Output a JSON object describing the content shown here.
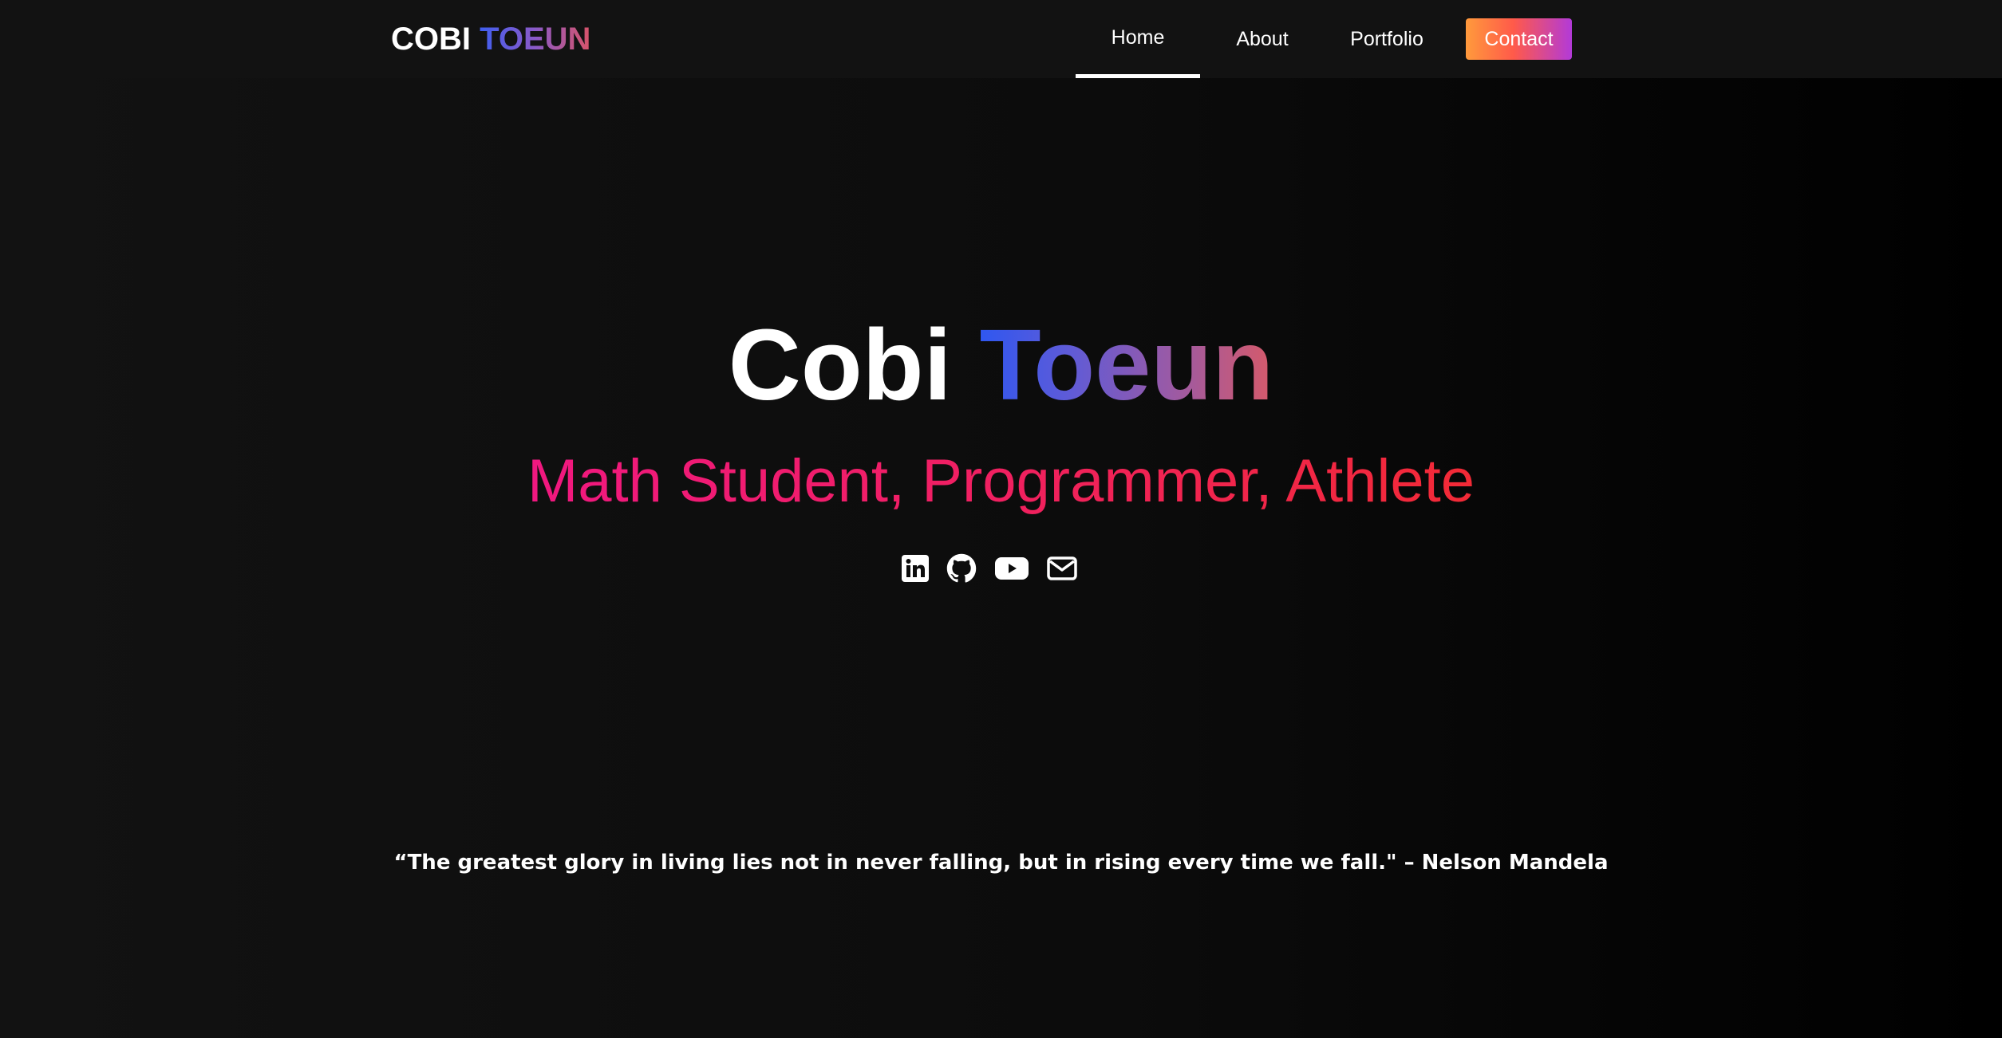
{
  "brand": {
    "first": "COBI",
    "last": "TOEUN"
  },
  "nav": {
    "home": "Home",
    "about": "About",
    "portfolio": "Portfolio",
    "contact": "Contact"
  },
  "hero": {
    "first_name": "Cobi",
    "last_name": "Toeun",
    "subtitle": "Math Student, Programmer, Athlete"
  },
  "socials": [
    "linkedin-icon",
    "github-icon",
    "youtube-icon",
    "envelope-icon"
  ],
  "quote": "“The greatest glory in living lies not in never falling, but in rising every time we fall.\" – Nelson Mandela",
  "colors": {
    "background": "#0b0b0b",
    "navbar": "#121212",
    "name_gradient": [
      "#2f57f0",
      "#d65a6a"
    ],
    "subtitle_gradient": [
      "#f01880",
      "#f22a36"
    ],
    "contact_gradient": [
      "#ff9a3c",
      "#b23ad8"
    ]
  }
}
